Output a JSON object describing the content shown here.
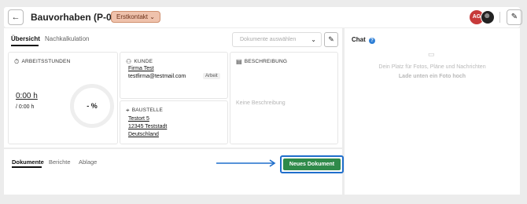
{
  "header": {
    "back_icon": "arrow-left-icon",
    "title": "Bauvorhaben (P-00121)",
    "status_badge": "Erstkontakt ⌄",
    "avatar_initials": "AG",
    "edit_icon": "pencil-icon"
  },
  "tabs": [
    {
      "label": "Übersicht",
      "active": true
    },
    {
      "label": "Nachkalkulation",
      "active": false
    }
  ],
  "documents_select": {
    "placeholder": "Dokumente auswählen"
  },
  "arbeitsstunden": {
    "heading": "ARBEITSSTUNDEN",
    "actual": "0:00 h",
    "planned": "/ 0:00 h",
    "gauge_label": "- %"
  },
  "kunde": {
    "heading": "KUNDE",
    "name": "Firma Test",
    "email": "testfirma@testmail.com",
    "email_tag": "Arbeit"
  },
  "baustelle": {
    "heading": "BAUSTELLE",
    "street": "Testort 5",
    "city": "12345 Teststadt",
    "country": "Deutschland"
  },
  "beschreibung": {
    "heading": "BESCHREIBUNG",
    "empty_text": "Keine Beschreibung"
  },
  "bottom_tabs": [
    {
      "label": "Dokumente",
      "active": true
    },
    {
      "label": "Berichte",
      "active": false
    },
    {
      "label": "Ablage",
      "active": false
    }
  ],
  "new_document_button": "Neues Dokument",
  "chat": {
    "title": "Chat",
    "line1": "Dein Platz für Fotos, Pläne und Nachrichten",
    "line2": "Lade unten ein Foto hoch"
  },
  "colors": {
    "badge": "#efc2ac",
    "primary_button": "#2f8a4a",
    "highlight": "#1f6ecb",
    "avatar": "#c73a3a"
  }
}
